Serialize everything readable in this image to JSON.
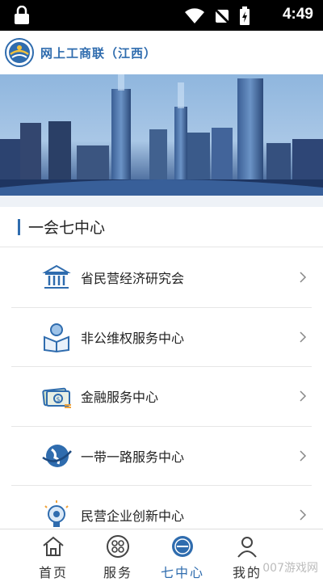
{
  "status_bar": {
    "time": "4:49",
    "icons": [
      "lock-icon",
      "wifi-icon",
      "no-sim-icon",
      "battery-charging-icon"
    ]
  },
  "header": {
    "title": "网上工商联（江西）",
    "logo_icon": "federation-logo-icon"
  },
  "banner": {
    "description_icon": "city-skyline-banner"
  },
  "section": {
    "title": "一会七中心"
  },
  "list_items": [
    {
      "label": "省民营经济研究会",
      "icon": "institute-building-icon"
    },
    {
      "label": "非公维权服务中心",
      "icon": "reading-person-icon"
    },
    {
      "label": "金融服务中心",
      "icon": "money-icon"
    },
    {
      "label": "一带一路服务中心",
      "icon": "globe-icon"
    },
    {
      "label": "民营企业创新中心",
      "icon": "lightbulb-icon"
    }
  ],
  "tabs": [
    {
      "label": "首页",
      "icon": "home-icon",
      "active": false
    },
    {
      "label": "服务",
      "icon": "grid-icon",
      "active": false
    },
    {
      "label": "七中心",
      "icon": "center-icon",
      "active": true
    },
    {
      "label": "我的",
      "icon": "user-icon",
      "active": false
    }
  ],
  "colors": {
    "brand": "#2f6cae",
    "divider": "#e6e6e6",
    "text": "#222222"
  },
  "watermark": "007游戏网"
}
